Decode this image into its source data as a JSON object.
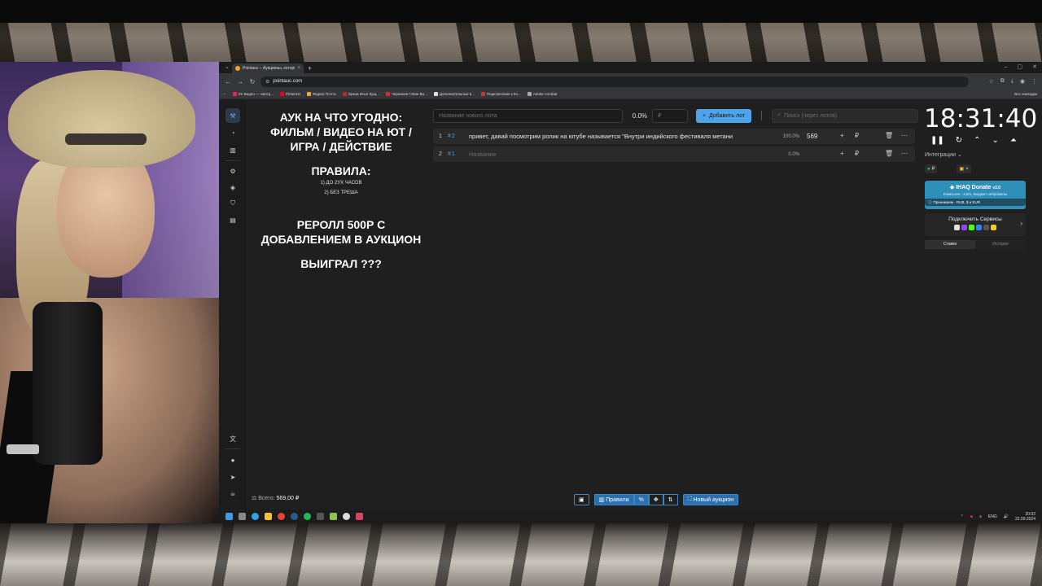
{
  "browser": {
    "tab_title": "Pointauc – Аукционы, которые...",
    "url": "pointauc.com",
    "bookmarks": [
      {
        "label": "VK Видео — смотр...",
        "color": "#e0245e"
      },
      {
        "label": "Pinterest",
        "color": "#e60023"
      },
      {
        "label": "Яндекс Почта",
        "color": "#f5a623"
      },
      {
        "label": "Оркэа Илья Кущ...",
        "color": "#cc2222"
      },
      {
        "label": "Черников Глеин Во...",
        "color": "#d03030"
      },
      {
        "label": "Дополнительные в...",
        "color": "#dddddd"
      },
      {
        "label": "Подключение к Ко...",
        "color": "#d03030"
      },
      {
        "label": "Adobe Acrobat",
        "color": "#aaaaaa"
      }
    ],
    "bookmarks_all": "Все закладки"
  },
  "rules_panel": {
    "line1": "АУК НА ЧТО УГОДНО:",
    "line2": "ФИЛЬМ / ВИДЕО НА ЮТ /",
    "line3": "ИГРА / ДЕЙСТВИЕ",
    "rules_title": "ПРАВИЛА:",
    "rule1": "1) ДО 2УХ ЧАСОВ",
    "rule2": "2) БЕЗ ТРЕША",
    "reroll1": "РЕРОЛЛ 500Р С",
    "reroll2": "ДОБАВЛЕНИЕМ В АУКЦИОН",
    "won": "ВЫИГРАЛ ???"
  },
  "topbar": {
    "lot_name_placeholder": "Название нового лота",
    "percent": "0.0%",
    "amount_placeholder": "₽",
    "add_lot_label": "Добавить лот",
    "search_placeholder": "Поиск (через лотов)"
  },
  "lots": [
    {
      "num": "1",
      "id": "2",
      "name": "привет, давай посмотрим ролик на ютубе называется \"Внутри индийского фестиваля метани",
      "percent": "100.0%",
      "amount": "569",
      "placeholder": false
    },
    {
      "num": "2",
      "id": "1",
      "name": "Название",
      "percent": "0.0%",
      "amount": "",
      "placeholder": true
    }
  ],
  "right_panel": {
    "timer": "18:31:40",
    "integrations_label": "Интеграции",
    "donate_title": "IHAQ Donate",
    "donate_version": "v3.0",
    "donate_sub": "Комиссия - 3,5%, Бюджет неброжены",
    "donate_bottom": "Принимаем - RUB, $ и EUR",
    "services_title": "Подключить Сервисы",
    "tab_bets": "Ставки",
    "tab_history": "История"
  },
  "bottom": {
    "total_label": "Всего:",
    "total_value": "569,00 ₽",
    "rules_button": "Правила",
    "new_auction_button": "Новый аукцион"
  },
  "taskbar": {
    "lang": "ENG",
    "time": "20:02",
    "date": "22.09.2024"
  }
}
